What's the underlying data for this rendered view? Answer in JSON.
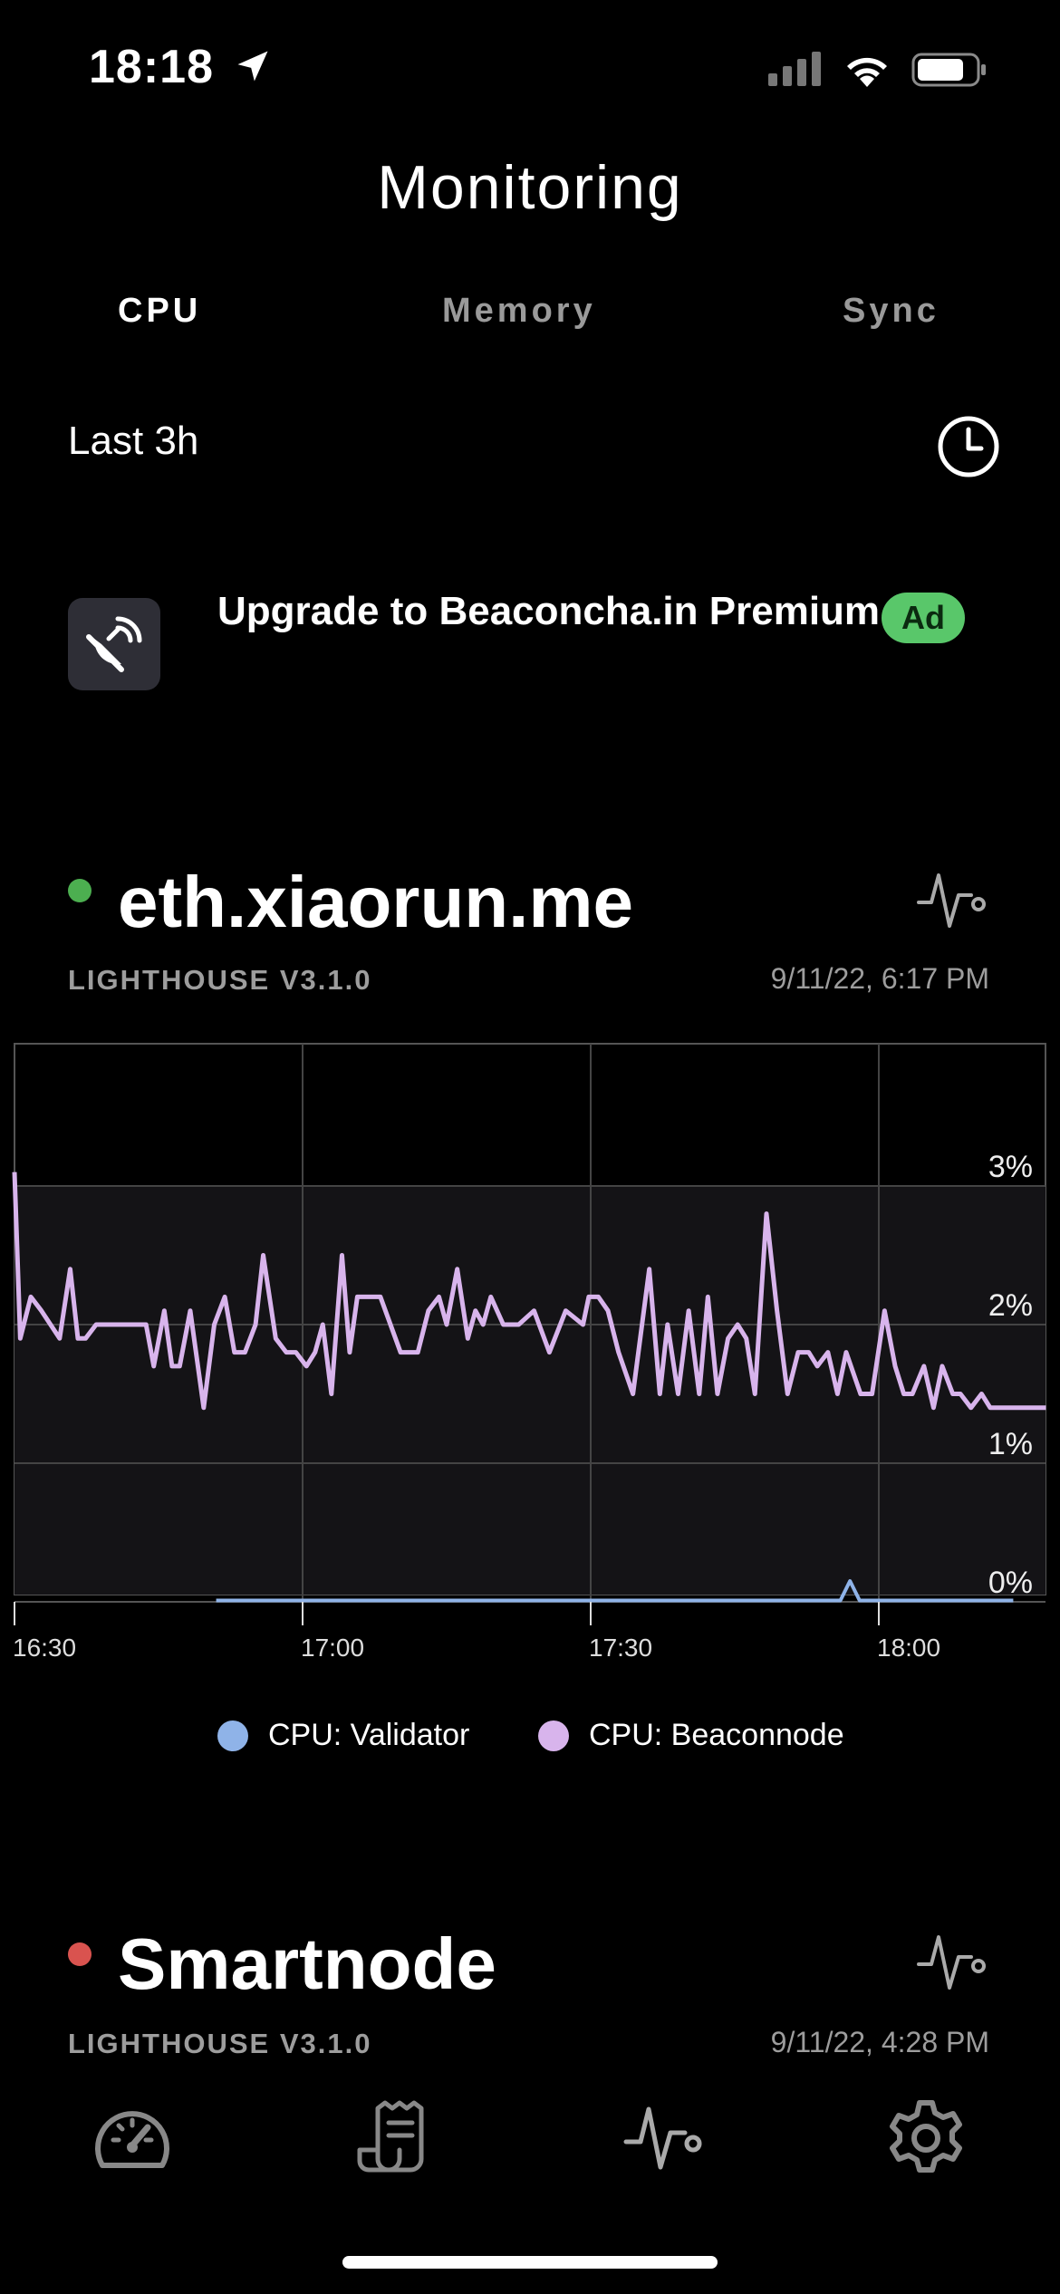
{
  "status_bar": {
    "time": "18:18"
  },
  "header": {
    "title": "Monitoring"
  },
  "tabs": [
    {
      "label": "CPU",
      "active": true
    },
    {
      "label": "Memory",
      "active": false
    },
    {
      "label": "Sync",
      "active": false
    }
  ],
  "range": {
    "label": "Last 3h",
    "icon": "clock-icon"
  },
  "ad": {
    "text": "Upgrade to Beaconcha.in Premium",
    "badge": "Ad",
    "icon": "satellite-dish-icon"
  },
  "nodes": [
    {
      "name": "eth.xiaorun.me",
      "status_color": "#4caf50",
      "client": "LIGHTHOUSE V3.1.0",
      "timestamp": "9/11/22, 6:17 PM"
    },
    {
      "name": "Smartnode",
      "status_color": "#d9534f",
      "client": "LIGHTHOUSE V3.1.0",
      "timestamp": "9/11/22, 4:28 PM"
    }
  ],
  "chart_data": {
    "type": "line",
    "x_ticks": [
      "16:30",
      "17:00",
      "17:30",
      "18:00"
    ],
    "y_ticks": [
      "0%",
      "1%",
      "2%",
      "3%"
    ],
    "ylim": [
      0,
      4
    ],
    "legend_position": "bottom",
    "grid": true,
    "series": [
      {
        "name": "CPU: Validator",
        "color": "#8fb3e8",
        "x_minutes": [
          21,
          35,
          80,
          86,
          87,
          88,
          104
        ],
        "values": [
          0.01,
          0.01,
          0.01,
          0.01,
          0.15,
          0.01,
          0.01
        ]
      },
      {
        "name": "CPU: Beaconnode",
        "color": "#d8b4ec",
        "x_minutes": [
          0,
          0.6,
          1.7,
          2.8,
          4.7,
          5.8,
          6.6,
          7.4,
          8.5,
          9.5,
          11.3,
          13.7,
          14.5,
          15.6,
          16.4,
          17.2,
          18.3,
          19.7,
          20.8,
          21.9,
          22.9,
          24.0,
          25.1,
          25.9,
          27.2,
          28.3,
          29.3,
          30.4,
          31.3,
          32.1,
          33.0,
          34.1,
          34.9,
          35.7,
          36.5,
          38.1,
          40.2,
          42.0,
          43.1,
          44.2,
          45.0,
          46.1,
          47.2,
          48.0,
          48.8,
          49.6,
          50.9,
          52.5,
          54.1,
          55.7,
          57.4,
          59.2,
          59.8,
          60.8,
          61.8,
          62.9,
          64.4,
          66.1,
          67.2,
          68.0,
          69.1,
          70.2,
          71.3,
          72.2,
          73.2,
          74.3,
          75.3,
          76.2,
          77.1,
          78.3,
          79.4,
          80.5,
          81.6,
          82.7,
          83.6,
          84.7,
          85.7,
          86.6,
          88.1,
          89.3,
          90.6,
          91.7,
          92.6,
          93.5,
          94.7,
          95.7,
          96.6,
          97.7,
          98.5,
          99.6,
          100.7,
          101.6,
          102.4,
          103.4,
          104.5,
          105.3,
          106.3,
          107.4
        ],
        "values": [
          3.1,
          1.9,
          2.2,
          2.1,
          1.9,
          2.4,
          1.9,
          1.9,
          2.0,
          2.0,
          2.0,
          2.0,
          1.7,
          2.1,
          1.7,
          1.7,
          2.1,
          1.4,
          2.0,
          2.2,
          1.8,
          1.8,
          2.0,
          2.5,
          1.9,
          1.8,
          1.8,
          1.7,
          1.8,
          2.0,
          1.5,
          2.5,
          1.8,
          2.2,
          2.2,
          2.2,
          1.8,
          1.8,
          2.1,
          2.2,
          2.0,
          2.4,
          1.9,
          2.1,
          2.0,
          2.2,
          2.0,
          2.0,
          2.1,
          1.8,
          2.1,
          2.0,
          2.2,
          2.2,
          2.1,
          1.8,
          1.5,
          2.4,
          1.5,
          2.0,
          1.5,
          2.1,
          1.5,
          2.2,
          1.5,
          1.9,
          2.0,
          1.9,
          1.5,
          2.8,
          2.1,
          1.5,
          1.8,
          1.8,
          1.7,
          1.8,
          1.5,
          1.8,
          1.5,
          1.5,
          2.1,
          1.7,
          1.5,
          1.5,
          1.7,
          1.4,
          1.7,
          1.5,
          1.5,
          1.4,
          1.5,
          1.4,
          1.4,
          1.4,
          1.4,
          1.4,
          1.4,
          1.4
        ]
      }
    ]
  },
  "bottom_nav": [
    {
      "icon": "dashboard-icon",
      "active": false
    },
    {
      "icon": "receipt-icon",
      "active": false
    },
    {
      "icon": "pulse-icon",
      "active": true
    },
    {
      "icon": "gear-icon",
      "active": false
    }
  ]
}
